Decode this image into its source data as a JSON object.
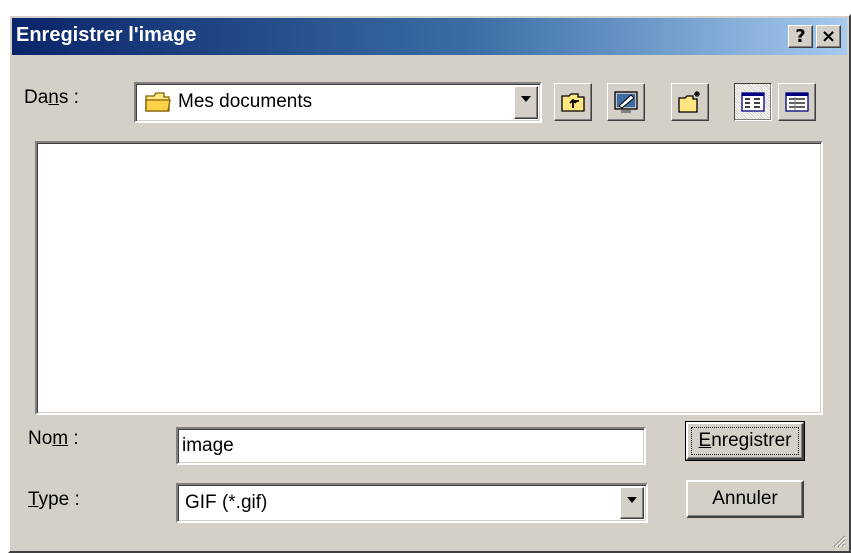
{
  "window": {
    "title": "Enregistrer l'image",
    "help_glyph": "?",
    "close_glyph": "×"
  },
  "location": {
    "label_prefix": "Da",
    "label_accel": "n",
    "label_suffix": "s :",
    "folder_name": "Mes documents",
    "folder_icon": "folder-icon"
  },
  "toolbar": {
    "buttons": [
      {
        "name": "up-one-level",
        "icon": "up-folder-icon"
      },
      {
        "name": "desktop",
        "icon": "desktop-icon"
      },
      {
        "name": "new-folder",
        "icon": "new-folder-icon"
      },
      {
        "name": "list-view",
        "icon": "list-view-icon",
        "pressed": true
      },
      {
        "name": "details-view",
        "icon": "details-view-icon"
      }
    ]
  },
  "file_list": {
    "items": []
  },
  "filename": {
    "label_prefix": "No",
    "label_accel": "m",
    "label_suffix": " :",
    "value": "image"
  },
  "filetype": {
    "label_accel": "T",
    "label_suffix": "ype :",
    "selected": "GIF (*.gif)"
  },
  "buttons": {
    "save_accel": "E",
    "save_rest": "nregistrer",
    "cancel_label": "Annuler"
  },
  "colors": {
    "titlebar_start": "#0a246a",
    "titlebar_end": "#a6caf0",
    "face": "#d4d0c8"
  }
}
